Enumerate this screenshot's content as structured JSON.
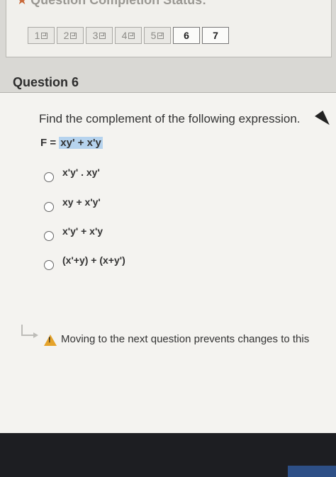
{
  "status": {
    "title": "Question Completion Status:"
  },
  "question_nav": [
    {
      "label": "1",
      "saved": true
    },
    {
      "label": "2",
      "saved": true
    },
    {
      "label": "3",
      "saved": true
    },
    {
      "label": "4",
      "saved": true
    },
    {
      "label": "5",
      "saved": true
    },
    {
      "label": "6",
      "saved": false
    },
    {
      "label": "7",
      "saved": false
    }
  ],
  "question": {
    "heading": "Question 6",
    "prompt": "Find the complement of the following expression.",
    "expr_prefix": "F = ",
    "expr_highlight": "xy' + x'y",
    "options": [
      "x'y' . xy'",
      "xy + x'y'",
      "x'y' + x'y",
      "(x'+y) + (x+y')"
    ]
  },
  "warning": {
    "text": "Moving to the next question prevents changes to this"
  }
}
